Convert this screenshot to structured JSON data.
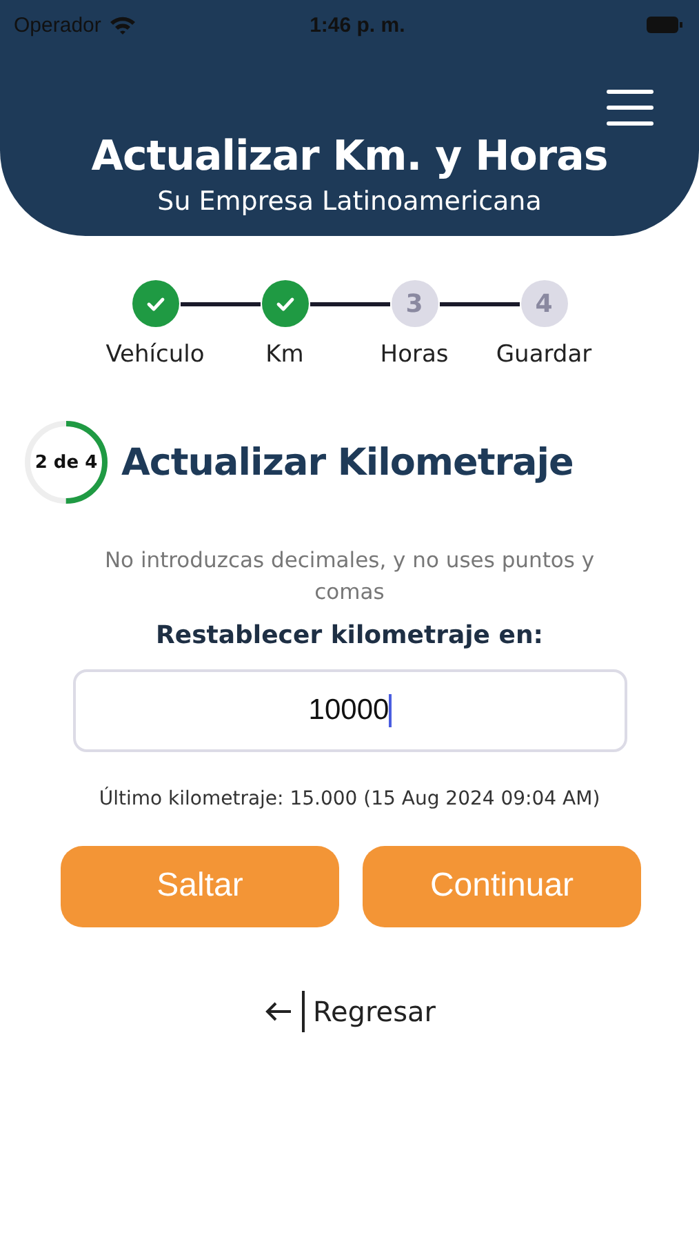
{
  "status_bar": {
    "carrier": "Operador",
    "time": "1:46 p. m."
  },
  "header": {
    "title": "Actualizar Km. y Horas",
    "subtitle": "Su Empresa Latinoamericana"
  },
  "steps": [
    {
      "label": "Vehículo",
      "completed": true
    },
    {
      "label": "Km",
      "completed": true
    },
    {
      "number": "3",
      "label": "Horas",
      "completed": false
    },
    {
      "number": "4",
      "label": "Guardar",
      "completed": false
    }
  ],
  "section": {
    "progress_text": "2 de 4",
    "level": 0.5,
    "title": "Actualizar Kilometraje"
  },
  "hint": "No introduzcas decimales, y no uses puntos y comas",
  "field_label": "Restablecer kilometraje en:",
  "field_value": "10000",
  "last_reading": "Último kilometraje: 15.000  (15 Aug 2024 09:04 AM)",
  "buttons": [
    "Saltar",
    "Continuar"
  ],
  "back_link": "Regresar"
}
